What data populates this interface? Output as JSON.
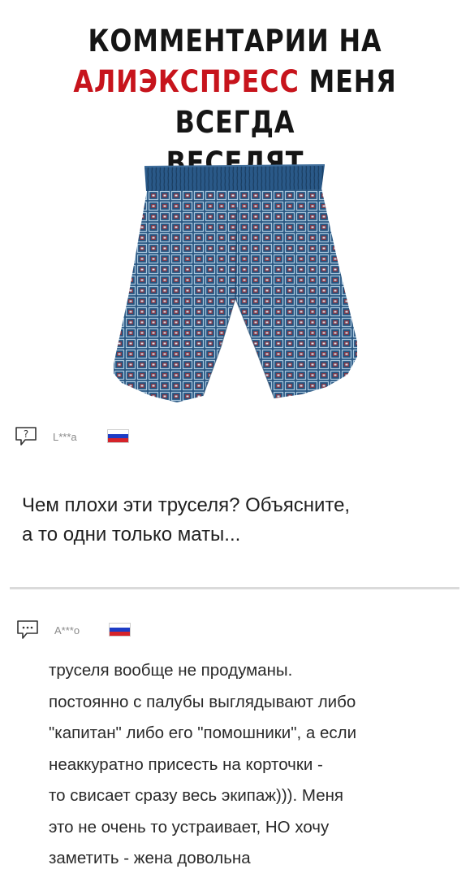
{
  "headline": {
    "line1": "КОММЕНТАРИИ НА",
    "accent": "АЛИЭКСПРЕСС",
    "line2_rest": " МЕНЯ ВСЕГДА",
    "line3": "ВЕСЕЛЯТ",
    "accent_color": "#c7141c"
  },
  "product": {
    "image": "blue-patterned-boxer-shorts"
  },
  "question": {
    "icon": "question-bubble-icon",
    "author": "L***a",
    "flag": "russia-flag",
    "lines": [
      "Чем плохи эти труселя? Объясните,",
      "а то одни только маты..."
    ]
  },
  "answer": {
    "icon": "ellipsis-bubble-icon",
    "author": "A***o",
    "flag": "russia-flag",
    "lines": [
      "труселя вообще не продуманы.",
      "постоянно с палубы выглядывают либо",
      "\"капитан\" либо его \"помошники\", а если",
      "неаккуратно присесть на корточки -",
      "то свисает сразу весь экипаж))). Меня",
      "это не очень то устраивает, НО хочу",
      "заметить - жена довольна"
    ]
  }
}
